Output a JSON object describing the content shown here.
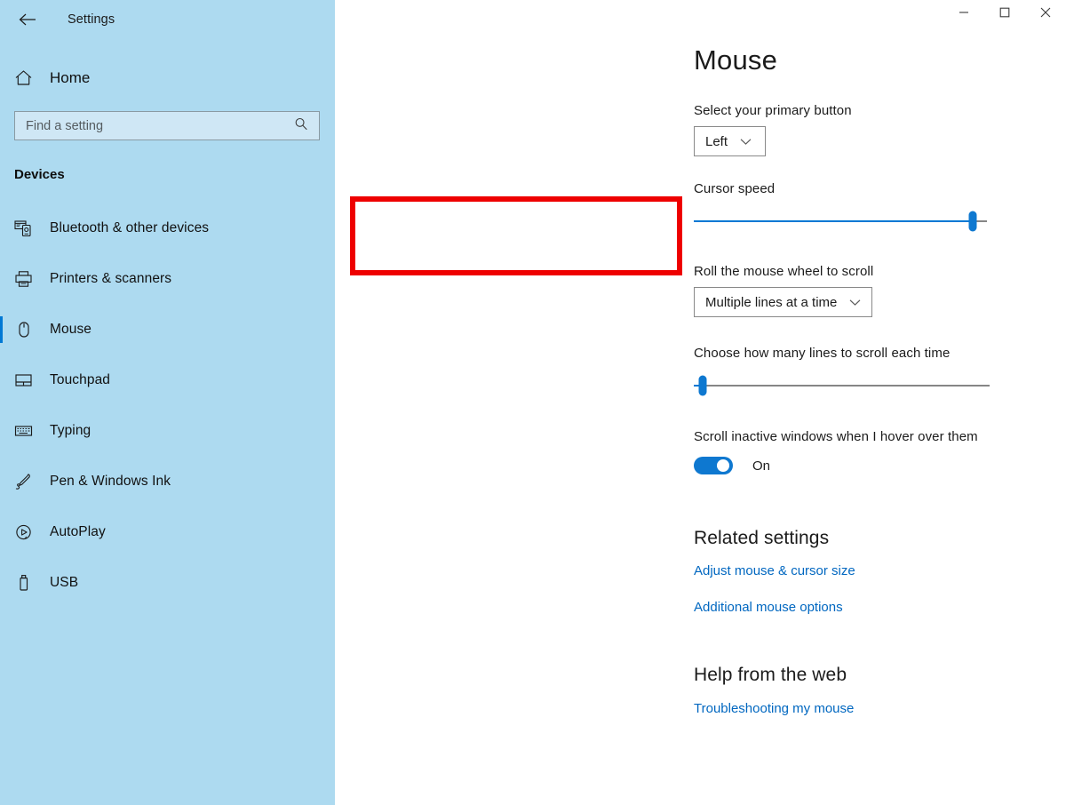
{
  "titlebar": {
    "back_label": "Back",
    "back_icon": "arrow-left-icon",
    "app_title": "Settings",
    "minimize_label": "Minimize",
    "maximize_label": "Maximize",
    "close_label": "Close"
  },
  "sidebar": {
    "home_label": "Home",
    "home_icon": "home-icon",
    "search": {
      "placeholder": "Find a setting",
      "value": "",
      "icon": "search-icon"
    },
    "section_title": "Devices",
    "items": [
      {
        "label": "Bluetooth & other devices",
        "icon": "devices-icon",
        "selected": false
      },
      {
        "label": "Printers & scanners",
        "icon": "printer-icon",
        "selected": false
      },
      {
        "label": "Mouse",
        "icon": "mouse-icon",
        "selected": true
      },
      {
        "label": "Touchpad",
        "icon": "touchpad-icon",
        "selected": false
      },
      {
        "label": "Typing",
        "icon": "keyboard-icon",
        "selected": false
      },
      {
        "label": "Pen & Windows Ink",
        "icon": "pen-icon",
        "selected": false
      },
      {
        "label": "AutoPlay",
        "icon": "autoplay-icon",
        "selected": false
      },
      {
        "label": "USB",
        "icon": "usb-icon",
        "selected": false
      }
    ]
  },
  "main": {
    "page_title": "Mouse",
    "primary_button": {
      "label": "Select your primary button",
      "value": "Left",
      "chevron_icon": "chevron-down-icon"
    },
    "cursor_speed": {
      "label": "Cursor speed",
      "value": 95,
      "min": 0,
      "max": 100,
      "highlighted": true,
      "highlight_color": "#ee0000"
    },
    "wheel_scroll": {
      "label": "Roll the mouse wheel to scroll",
      "value": "Multiple lines at a time",
      "chevron_icon": "chevron-down-icon"
    },
    "lines_to_scroll": {
      "label": "Choose how many lines to scroll each time",
      "value": 4,
      "min": 1,
      "max": 100
    },
    "inactive_scroll": {
      "label": "Scroll inactive windows when I hover over them",
      "state": "On",
      "enabled": true
    },
    "related_settings": {
      "title": "Related settings",
      "links": [
        "Adjust mouse & cursor size",
        "Additional mouse options"
      ]
    },
    "help_web": {
      "title": "Help from the web",
      "links": [
        "Troubleshooting my mouse"
      ]
    }
  },
  "colors": {
    "accent": "#0078d4",
    "sidebar_bg": "#addaf0",
    "link": "#0067c0",
    "annotation": "#ee0000"
  }
}
